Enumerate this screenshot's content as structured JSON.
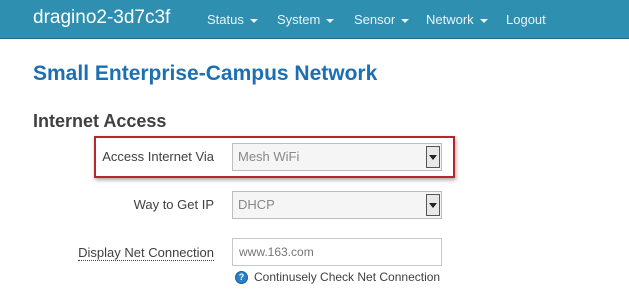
{
  "navbar": {
    "brand": "dragino2-3d7c3f",
    "items": [
      {
        "label": "Status",
        "has_menu": true
      },
      {
        "label": "System",
        "has_menu": true
      },
      {
        "label": "Sensor",
        "has_menu": true
      },
      {
        "label": "Network",
        "has_menu": true
      },
      {
        "label": "Logout",
        "has_menu": false
      }
    ],
    "background_color": "#2f8fb0"
  },
  "page": {
    "title": "Small Enterprise-Campus Network",
    "section_title": "Internet Access"
  },
  "form": {
    "access_internet_via": {
      "label": "Access Internet Via",
      "value": "Mesh WiFi"
    },
    "way_to_get_ip": {
      "label": "Way to Get IP",
      "value": "DHCP"
    },
    "display_net_connection": {
      "label": "Display Net Connection",
      "value": "",
      "placeholder": "www.163.com"
    },
    "help": {
      "text": "Continusely Check Net Connection",
      "icon": "question-icon"
    }
  },
  "colors": {
    "title": "#1c6fb3",
    "highlight": "#b3272d"
  }
}
